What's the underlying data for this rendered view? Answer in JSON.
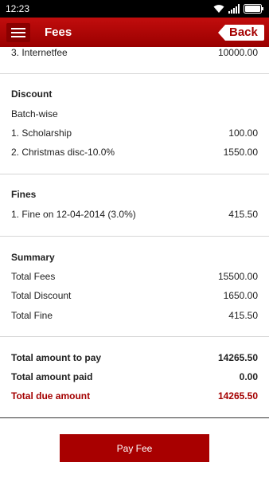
{
  "status_bar": {
    "time": "12:23"
  },
  "header": {
    "title": "Fees",
    "back_label": "Back"
  },
  "fees": {
    "partial_item": {
      "label": "3. Internetfee",
      "amount": "10000.00"
    }
  },
  "discount": {
    "heading": "Discount",
    "subheading": "Batch-wise",
    "items": [
      {
        "label": "1. Scholarship",
        "amount": "100.00"
      },
      {
        "label": "2. Christmas disc-10.0%",
        "amount": "1550.00"
      }
    ]
  },
  "fines": {
    "heading": "Fines",
    "items": [
      {
        "label": "1. Fine on 12-04-2014 (3.0%)",
        "amount": "415.50"
      }
    ]
  },
  "summary": {
    "heading": "Summary",
    "total_fees": {
      "label": "Total Fees",
      "amount": "15500.00"
    },
    "total_discount": {
      "label": "Total Discount",
      "amount": "1650.00"
    },
    "total_fine": {
      "label": "Total Fine",
      "amount": "415.50"
    }
  },
  "totals": {
    "to_pay": {
      "label": "Total amount to pay",
      "amount": "14265.50"
    },
    "paid": {
      "label": "Total amount paid",
      "amount": "0.00"
    },
    "due": {
      "label": "Total due amount",
      "amount": "14265.50"
    }
  },
  "pay_button": {
    "label": "Pay Fee"
  },
  "colors": {
    "primary": "#a80000",
    "due_text": "#a40000"
  }
}
